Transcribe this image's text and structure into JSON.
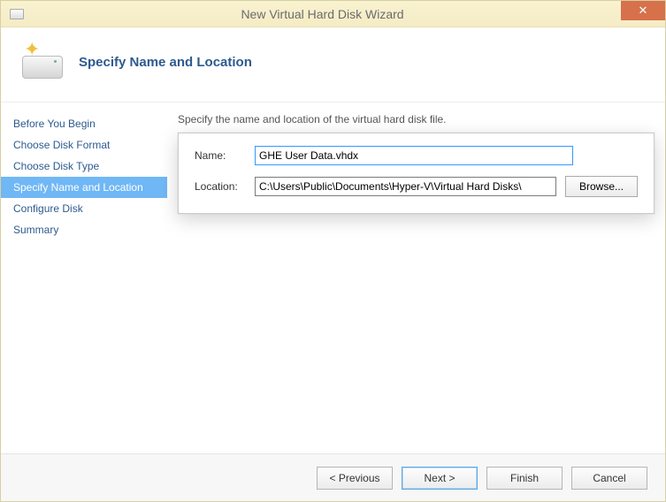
{
  "window": {
    "title": "New Virtual Hard Disk Wizard",
    "close_symbol": "✕"
  },
  "header": {
    "title": "Specify Name and Location",
    "icon": "hdd-with-star-icon"
  },
  "sidebar": {
    "items": [
      {
        "label": "Before You Begin",
        "active": false
      },
      {
        "label": "Choose Disk Format",
        "active": false
      },
      {
        "label": "Choose Disk Type",
        "active": false
      },
      {
        "label": "Specify Name and Location",
        "active": true
      },
      {
        "label": "Configure Disk",
        "active": false
      },
      {
        "label": "Summary",
        "active": false
      }
    ]
  },
  "main": {
    "instruction": "Specify the name and location of the virtual hard disk file.",
    "name_label": "Name:",
    "name_value": "GHE User Data.vhdx",
    "location_label": "Location:",
    "location_value": "C:\\Users\\Public\\Documents\\Hyper-V\\Virtual Hard Disks\\",
    "browse_label": "Browse..."
  },
  "footer": {
    "previous": "< Previous",
    "next": "Next >",
    "finish": "Finish",
    "cancel": "Cancel"
  }
}
